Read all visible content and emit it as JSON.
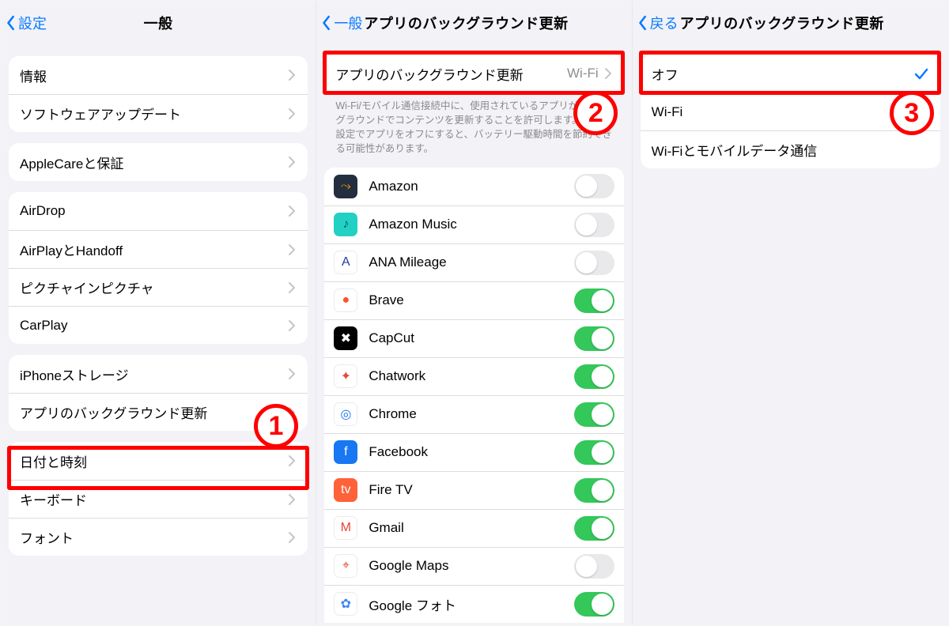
{
  "steps": {
    "one": "1",
    "two": "2",
    "three": "3"
  },
  "pane1": {
    "back_label": "設定",
    "title": "一般",
    "groups": [
      {
        "rows": [
          "情報",
          "ソフトウェアアップデート"
        ]
      },
      {
        "rows": [
          "AppleCareと保証"
        ]
      },
      {
        "rows": [
          "AirDrop",
          "AirPlayとHandoff",
          "ピクチャインピクチャ",
          "CarPlay"
        ]
      },
      {
        "rows": [
          "iPhoneストレージ",
          "アプリのバックグラウンド更新"
        ]
      },
      {
        "rows": [
          "日付と時刻",
          "キーボード",
          "フォント"
        ]
      }
    ]
  },
  "pane2": {
    "back_label": "一般",
    "title": "アプリのバックグラウンド更新",
    "header": {
      "label": "アプリのバックグラウンド更新",
      "value": "Wi-Fi"
    },
    "description": "Wi-Fi/モバイル通信接続中に、使用されているアプリがバックグラウンドでコンテンツを更新することを許可します。以下の設定でアプリをオフにすると、バッテリー駆動時間を節約できる可能性があります。",
    "apps": [
      {
        "name": "Amazon",
        "on": false,
        "bg": "#232f3e",
        "fg": "#ff9900",
        "g": "⤳"
      },
      {
        "name": "Amazon Music",
        "on": false,
        "bg": "#22d0c4",
        "fg": "#0b5a64",
        "g": "♪"
      },
      {
        "name": "ANA Mileage",
        "on": false,
        "bg": "#ffffff",
        "fg": "#1f3f9a",
        "g": "A"
      },
      {
        "name": "Brave",
        "on": true,
        "bg": "#ffffff",
        "fg": "#fb542b",
        "g": "●"
      },
      {
        "name": "CapCut",
        "on": true,
        "bg": "#000000",
        "fg": "#ffffff",
        "g": "✖"
      },
      {
        "name": "Chatwork",
        "on": true,
        "bg": "#ffffff",
        "fg": "#e24b3b",
        "g": "✦"
      },
      {
        "name": "Chrome",
        "on": true,
        "bg": "#ffffff",
        "fg": "#1a73e8",
        "g": "◎"
      },
      {
        "name": "Facebook",
        "on": true,
        "bg": "#1877f2",
        "fg": "#ffffff",
        "g": "f"
      },
      {
        "name": "Fire TV",
        "on": true,
        "bg": "#ff6138",
        "fg": "#ffffff",
        "g": "tv"
      },
      {
        "name": "Gmail",
        "on": true,
        "bg": "#ffffff",
        "fg": "#ea4335",
        "g": "M"
      },
      {
        "name": "Google Maps",
        "on": false,
        "bg": "#ffffff",
        "fg": "#ea4335",
        "g": "⌖"
      },
      {
        "name": "Google フォト",
        "on": true,
        "bg": "#ffffff",
        "fg": "#4285f4",
        "g": "✿"
      }
    ]
  },
  "pane3": {
    "back_label": "戻る",
    "title": "アプリのバックグラウンド更新",
    "options": [
      {
        "label": "オフ",
        "selected": true
      },
      {
        "label": "Wi-Fi",
        "selected": false
      },
      {
        "label": "Wi-Fiとモバイルデータ通信",
        "selected": false
      }
    ]
  }
}
